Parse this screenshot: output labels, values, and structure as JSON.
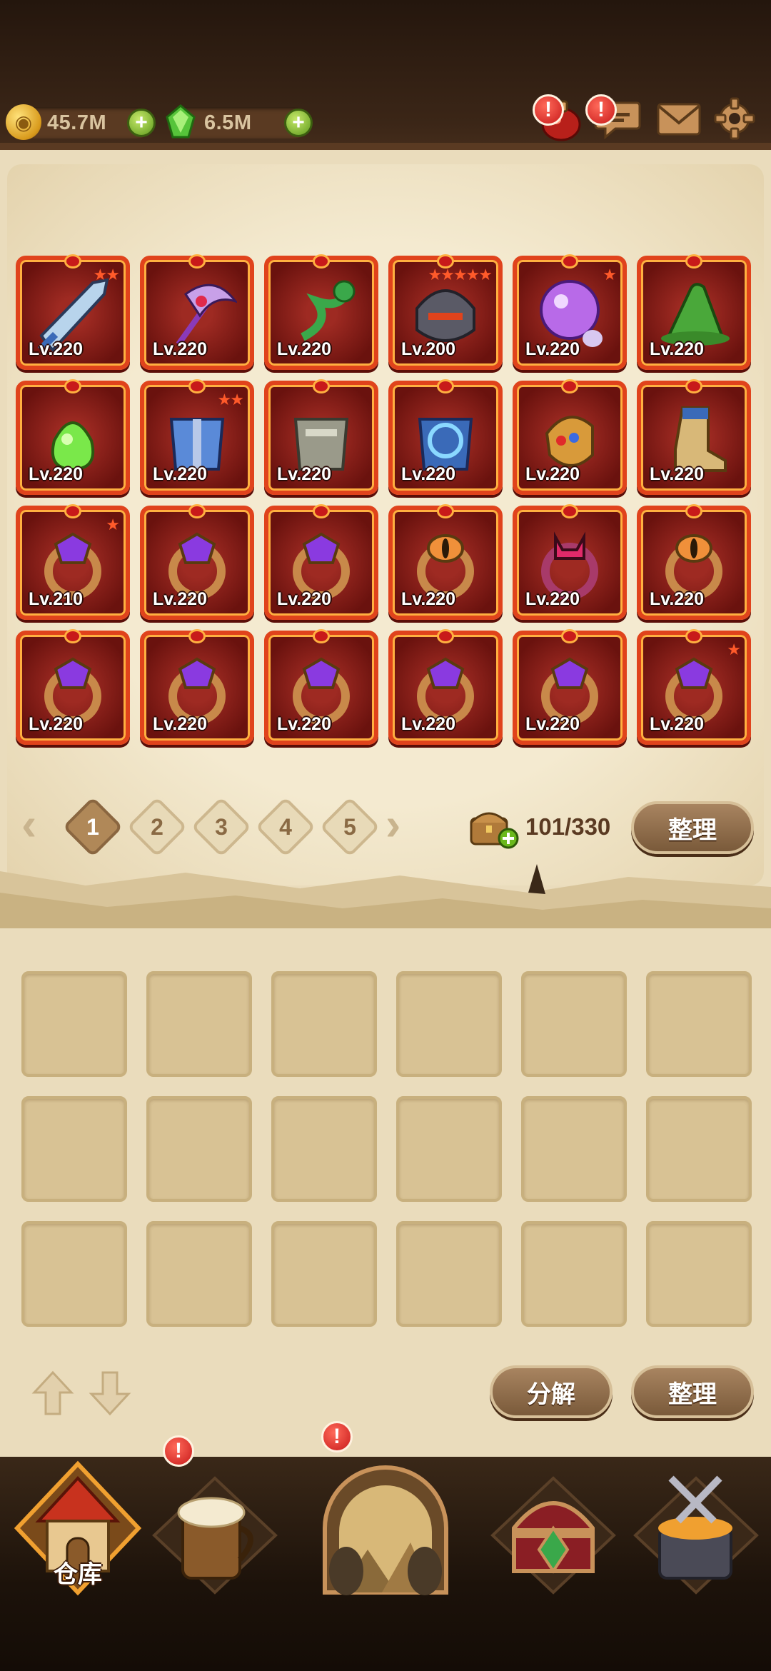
{
  "resources": {
    "gold": {
      "value": "45.7M",
      "icon": "gold-coin-icon"
    },
    "gems": {
      "value": "6.5M",
      "icon": "green-crystal-icon"
    }
  },
  "equipped": [
    {
      "icon": "sword-icon",
      "level": "Lv.220",
      "stars": "★★"
    },
    {
      "icon": "scythe-staff-icon",
      "level": "Lv.220",
      "stars": ""
    },
    {
      "icon": "dragon-staff-icon",
      "level": "Lv.220",
      "stars": ""
    },
    {
      "icon": "demon-helmet-icon",
      "level": "Lv.200",
      "stars": "★★★★★"
    },
    {
      "icon": "purple-orb-icon",
      "level": "Lv.220",
      "stars": "★"
    },
    {
      "icon": "wizard-hat-icon",
      "level": "Lv.220",
      "stars": ""
    },
    {
      "icon": "slime-amulet-icon",
      "level": "Lv.220",
      "stars": ""
    },
    {
      "icon": "blue-armor-icon",
      "level": "Lv.220",
      "stars": "★★"
    },
    {
      "icon": "steel-armor-icon",
      "level": "Lv.220",
      "stars": ""
    },
    {
      "icon": "vortex-cloak-icon",
      "level": "Lv.220",
      "stars": ""
    },
    {
      "icon": "golden-gauntlet-icon",
      "level": "Lv.220",
      "stars": ""
    },
    {
      "icon": "boot-icon",
      "level": "Lv.220",
      "stars": ""
    },
    {
      "icon": "purple-ring-icon",
      "level": "Lv.210",
      "stars": "★"
    },
    {
      "icon": "purple-ring-icon",
      "level": "Lv.220",
      "stars": ""
    },
    {
      "icon": "purple-ring-icon",
      "level": "Lv.220",
      "stars": ""
    },
    {
      "icon": "eye-ring-icon",
      "level": "Lv.220",
      "stars": ""
    },
    {
      "icon": "demon-ring-icon",
      "level": "Lv.220",
      "stars": ""
    },
    {
      "icon": "eye-ring-icon",
      "level": "Lv.220",
      "stars": ""
    },
    {
      "icon": "purple-ring-icon",
      "level": "Lv.220",
      "stars": ""
    },
    {
      "icon": "purple-ring-icon",
      "level": "Lv.220",
      "stars": ""
    },
    {
      "icon": "purple-ring-icon",
      "level": "Lv.220",
      "stars": ""
    },
    {
      "icon": "purple-ring-icon",
      "level": "Lv.220",
      "stars": ""
    },
    {
      "icon": "purple-ring-icon",
      "level": "Lv.220",
      "stars": ""
    },
    {
      "icon": "purple-ring-icon",
      "level": "Lv.220",
      "stars": "★"
    }
  ],
  "pagination": {
    "pages": [
      "1",
      "2",
      "3",
      "4",
      "5"
    ],
    "current": "1"
  },
  "capacity": "101/330",
  "buttons": {
    "sort_top": "整理",
    "dismantle": "分解",
    "sort_bottom": "整理"
  },
  "nav": {
    "warehouse_label": "仓库",
    "items": [
      "warehouse-icon",
      "tavern-icon",
      "adventure-portal-icon",
      "treasure-chest-icon",
      "forge-icon"
    ]
  },
  "colors": {
    "item_frame": "#e0431c",
    "parchment": "#eadcbc",
    "alert": "#c81a1a"
  }
}
